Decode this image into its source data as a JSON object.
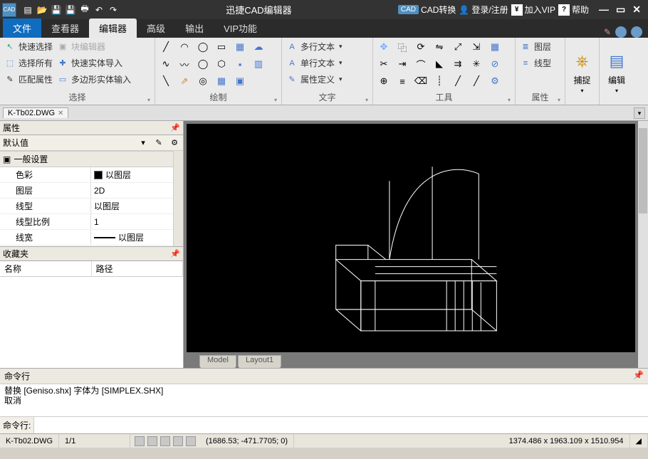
{
  "title": "迅捷CAD编辑器",
  "qat_logo": "CAD",
  "top_links": {
    "cad_convert_badge": "CAD",
    "cad_convert": "CAD转换",
    "login": "登录/注册",
    "vip": "加入VIP",
    "help": "帮助"
  },
  "menu_tabs": {
    "file": "文件",
    "viewer": "查看器",
    "editor": "编辑器",
    "advanced": "高级",
    "output": "输出",
    "vip": "VIP功能"
  },
  "ribbon": {
    "select": {
      "quick_select": "快速选择",
      "block_editor": "块编辑器",
      "select_all": "选择所有",
      "quick_entity_import": "快速实体导入",
      "match_props": "匹配属性",
      "polygon_entity_input": "多边形实体输入",
      "label": "选择"
    },
    "draw": {
      "label": "绘制"
    },
    "text": {
      "mtext": "多行文本",
      "stext": "单行文本",
      "attdef": "属性定义",
      "label": "文字"
    },
    "tools": {
      "label": "工具"
    },
    "props": {
      "layer": "图层",
      "linetype": "线型",
      "label": "属性"
    },
    "snap": "捕捉",
    "edit": "编辑"
  },
  "document_tab": "K-Tb02.DWG",
  "panels": {
    "properties": "属性",
    "default_value": "默认值",
    "general_settings": "一般设置",
    "rows": {
      "color": "色彩",
      "color_val": "以图层",
      "layer": "图层",
      "layer_val": "2D",
      "linetype": "线型",
      "linetype_val": "以图层",
      "ltscale": "线型比例",
      "ltscale_val": "1",
      "lineweight": "线宽",
      "lineweight_val": "以图层"
    },
    "favorites": "收藏夹",
    "fav_col_name": "名称",
    "fav_col_path": "路径"
  },
  "canvas_tabs": {
    "model": "Model",
    "layout1": "Layout1"
  },
  "command": {
    "title": "命令行",
    "log1": "替换 [Geniso.shx] 字体为 [SIMPLEX.SHX]",
    "log2": "取消",
    "prompt": "命令行:"
  },
  "status": {
    "file": "K-Tb02.DWG",
    "page": "1/1",
    "coords": "(1686.53; -471.7705; 0)",
    "dims": "1374.486 x 1963.109 x 1510.954"
  }
}
